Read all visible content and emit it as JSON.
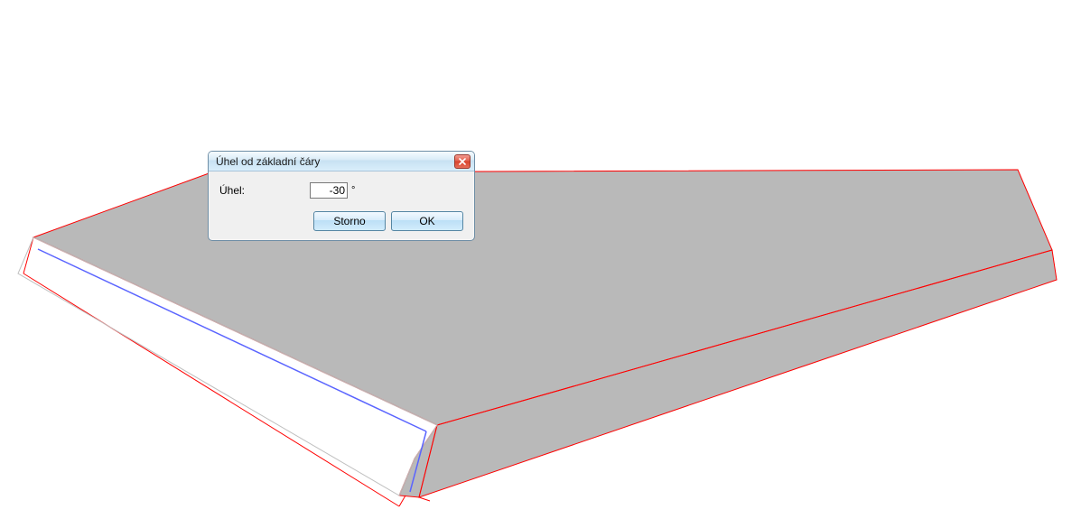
{
  "viewport": {
    "slab_fill": "#b9b9b9",
    "edge_red": "#ff0000",
    "edge_blue": "#5a64ff",
    "edge_gray": "#bfbfbf",
    "polys": {
      "top": "37,263 234,191 1127,188 1165,277 484,471",
      "front": "484,471 1165,277 1170,310 464,551",
      "front_bevel": "484,471 464,551 442,549 459,508",
      "left": "37,263 484,471 459,508 442,549 20,303"
    },
    "extra_red_lines": [
      [
        37,
        263,
        26,
        303
      ],
      [
        26,
        303,
        442,
        561
      ],
      [
        442,
        561,
        449,
        549
      ],
      [
        476,
        555,
        464,
        551
      ]
    ],
    "blue_lines": [
      [
        42,
        276,
        472,
        478
      ],
      [
        472,
        478,
        454,
        545
      ]
    ]
  },
  "dialog": {
    "title": "Úhel od základní čáry",
    "field_label": "Úhel:",
    "angle_value": "-30",
    "unit": "°",
    "storno_label": "Storno",
    "ok_label": "OK"
  }
}
